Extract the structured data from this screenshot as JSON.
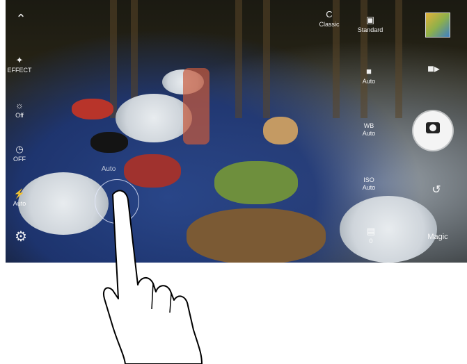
{
  "left_bar": {
    "collapse": {
      "icon": "chevron-up-icon"
    },
    "effect": {
      "icon": "magic-wand-icon",
      "label": "EFFECT"
    },
    "hdr": {
      "icon": "hdr-icon",
      "label": "Off"
    },
    "timer": {
      "icon": "timer-icon",
      "label": "OFF"
    },
    "flash": {
      "icon": "flash-icon",
      "label": "Auto"
    },
    "settings": {
      "icon": "gear-icon"
    }
  },
  "top_bar": {
    "mode": {
      "icon": "camera-mode-icon",
      "label": "Classic"
    },
    "resolution": {
      "icon": "aspect-icon",
      "label": "Standard"
    }
  },
  "right_panel": {
    "iso": {
      "icon": "iso-icon",
      "label": "Auto"
    },
    "white_balance": {
      "label_top": "WB",
      "label": "Auto"
    },
    "exposure": {
      "label_top": "ISO",
      "label": "Auto"
    },
    "ev": {
      "icon": "ev-icon",
      "label": "0"
    },
    "shutter_icon": "camera-icon",
    "video_icon": "video-camera-icon",
    "switch_icon": "switch-camera-icon",
    "manual_label": "Magic"
  },
  "overlay": {
    "focus_label": "Auto"
  },
  "colors": {
    "accent": "#ffffff",
    "shutter": "#f4f4f4"
  }
}
